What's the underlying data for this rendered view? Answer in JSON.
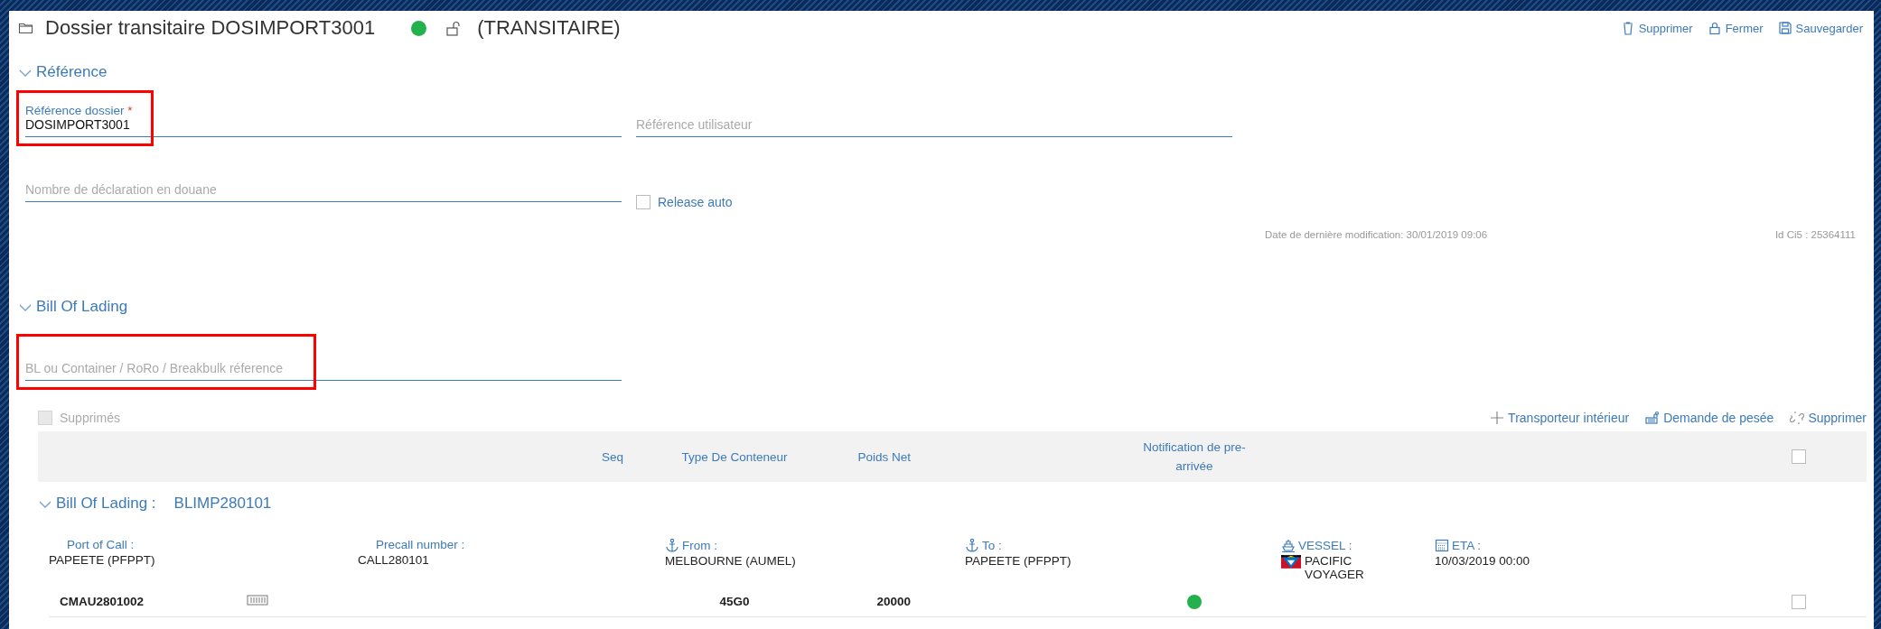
{
  "header": {
    "title": "Dossier transitaire DOSIMPORT3001",
    "locked": false,
    "role": "(TRANSITAIRE)"
  },
  "header_actions": [
    {
      "label": "Supprimer",
      "kind": "trash"
    },
    {
      "label": "Fermer",
      "kind": "lock"
    },
    {
      "label": "Sauvegarder",
      "kind": "save"
    }
  ],
  "reference_section": {
    "title": "Référence",
    "expanded": true,
    "fields": [
      {
        "label": "Référence dossier",
        "required_mark": "*",
        "value": "DOSIMPORT3001",
        "highlighted": true
      },
      {
        "placeholder": "Référence utilisateur",
        "highlighted": false
      },
      {
        "placeholder": "Nombre de déclaration en douane",
        "highlighted": false
      }
    ],
    "release_auto": {
      "label": "Release auto",
      "checked": false
    },
    "last_modified": "Date de dernière modification: 30/01/2019 09:06",
    "id": "Id Ci5 : 25364111"
  },
  "bl_section": {
    "title": "Bill Of Lading",
    "expanded": true,
    "search": {
      "placeholder": "BL ou Container / RoRo / Breakbulk réference",
      "highlighted": true
    },
    "show_deleted": {
      "label": "Supprimés",
      "checked": false,
      "disabled": true
    },
    "actions": [
      {
        "label": "Transporteur intérieur",
        "kind": "plus"
      },
      {
        "label": "Demande de pesée",
        "kind": "scale"
      },
      {
        "label": "Supprimer",
        "kind": "unlink"
      }
    ],
    "columns": [
      "Seq",
      "Type De Conteneur",
      "Poids Net",
      "Notification de pre-arrivée"
    ],
    "header_checked": false,
    "bill": {
      "label": "Bill Of Lading :",
      "number": "BLIMP280101",
      "expanded": true,
      "details": [
        {
          "label": "Port of Call :",
          "value": "PAPEETE (PFPPT)",
          "kind": "plain"
        },
        {
          "label": "Precall number :",
          "value": "CALL280101",
          "kind": "plain"
        },
        {
          "label": "From :",
          "value": "MELBOURNE (AUMEL)",
          "kind": "port"
        },
        {
          "label": "To :",
          "value": "PAPEETE (PFPPT)",
          "kind": "port"
        },
        {
          "label": "VESSEL :",
          "value": "PACIFIC VOYAGER",
          "kind": "vessel"
        },
        {
          "label": "ETA :",
          "value": "10/03/2019 00:00",
          "kind": "date"
        }
      ],
      "containers": [
        {
          "number": "CMAU2801002",
          "type": "45G0",
          "weight": "20000",
          "notified": true,
          "checked": false
        }
      ]
    }
  }
}
